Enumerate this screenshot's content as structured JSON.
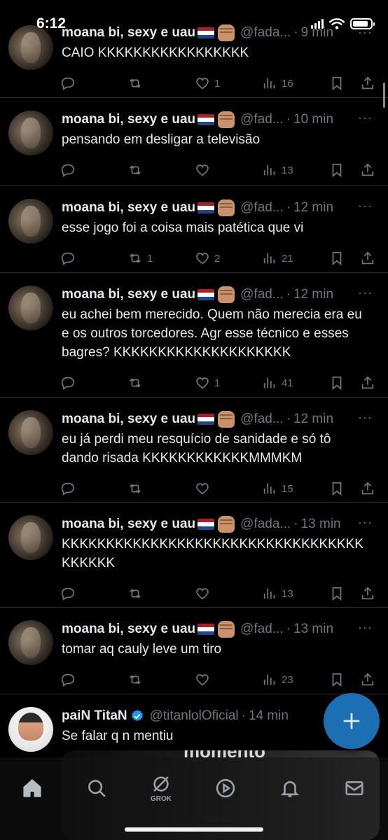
{
  "status": {
    "time": "6:12"
  },
  "colors": {
    "accent": "#1d6fb3",
    "muted": "#71767b",
    "background": "#000000",
    "flag": [
      "#ae1c28",
      "#ffffff",
      "#21468b"
    ]
  },
  "tweets": [
    {
      "name": "moana bi, sexy e uau",
      "handle": "@fada...",
      "time": "9 min",
      "text": "CAIO KKKKKKKKKKKKKKKKK",
      "replies": "",
      "retweets": "",
      "likes": "1",
      "views": "16"
    },
    {
      "name": "moana bi, sexy e uau",
      "handle": "@fad...",
      "time": "10 min",
      "text": "pensando em desligar a televisão",
      "replies": "",
      "retweets": "",
      "likes": "",
      "views": "13"
    },
    {
      "name": "moana bi, sexy e uau",
      "handle": "@fad...",
      "time": "12 min",
      "text": "esse jogo foi a coisa mais patética que vi",
      "replies": "",
      "retweets": "1",
      "likes": "2",
      "views": "21"
    },
    {
      "name": "moana bi, sexy e uau",
      "handle": "@fad...",
      "time": "12 min",
      "text": "eu achei bem merecido. Quem não merecia era eu e os outros torcedores. Agr esse técnico e esses bagres? KKKKKKKKKKKKKKKKKKKK",
      "replies": "",
      "retweets": "",
      "likes": "1",
      "views": "41"
    },
    {
      "name": "moana bi, sexy e uau",
      "handle": "@fad...",
      "time": "12 min",
      "text": "eu já perdi meu resquício de sanidade e só tô dando risada KKKKKKKKKKKKMMMKM",
      "replies": "",
      "retweets": "",
      "likes": "",
      "views": "15"
    },
    {
      "name": "moana bi, sexy e uau",
      "handle": "@fada...",
      "time": "13 min",
      "text": "KKKKKKKKKKKKKKKKKKKKKKKKKKKKKKKKKKKKKKKK",
      "replies": "",
      "retweets": "",
      "likes": "",
      "views": "13"
    },
    {
      "name": "moana bi, sexy e uau",
      "handle": "@fad...",
      "time": "13 min",
      "text": "tomar aq cauly leve um tiro",
      "replies": "",
      "retweets": "",
      "likes": "",
      "views": "23"
    }
  ],
  "last_tweet": {
    "name": "paiN TitaN",
    "handle": "@titanlolOficial",
    "time": "14 min",
    "text": "Se falar q n mentiu",
    "verified_icon": "verified-badge-icon"
  },
  "media_peek": {
    "caption": "momento"
  },
  "tabbar": {
    "grok_label": "GROK",
    "icons": [
      "home-icon",
      "search-icon",
      "grok-icon",
      "play-icon",
      "bell-icon",
      "mail-icon"
    ]
  },
  "fab": {
    "icon": "plus-icon"
  }
}
